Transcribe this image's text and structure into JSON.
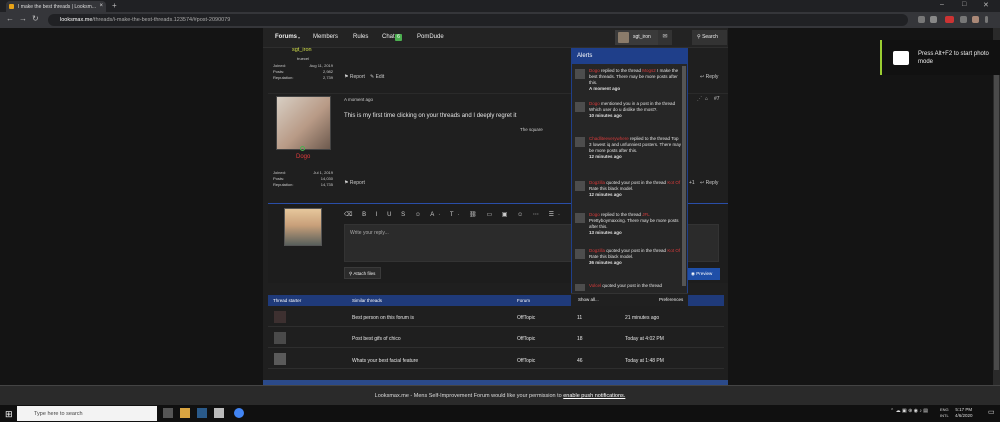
{
  "browser": {
    "tab_title": "I make the best threads | Looksm...",
    "new_tab": "+",
    "url_host": "looksmax.me",
    "url_path": "/threads/i-make-the-best-threads.123574/#post-2090079",
    "min": "–",
    "max": "□",
    "close": "✕",
    "back": "←",
    "forward": "→",
    "reload": "↻"
  },
  "nav": {
    "forums": "Forums",
    "members": "Members",
    "rules": "Rules",
    "chat": "Chat",
    "chat_badge": "6",
    "pomdude": "PomDude",
    "user": "sgt_iron",
    "search": "Search"
  },
  "post1": {
    "username": "sgt_iron",
    "title": "truecel",
    "joined_label": "Joined:",
    "joined": "Aug 11, 2019",
    "posts_label": "Posts:",
    "posts": "2,982",
    "rep_label": "Reputation:",
    "rep": "2,739",
    "report": "Report",
    "edit": "Edit",
    "reply": "Reply"
  },
  "post2": {
    "username": "Dogo",
    "time": "A moment ago",
    "text": "This is my first time clicking on your threads and I deeply regret it",
    "sub": "The square",
    "joined_label": "Joined:",
    "joined": "Jul 1, 2019",
    "posts_label": "Posts:",
    "posts": "14,030",
    "rep_label": "Reputation:",
    "rep": "14,735",
    "post_no": "#7",
    "reaction_count": "+1",
    "report": "Report",
    "reply": "Reply"
  },
  "editor": {
    "toolbar": "⌫ B I U S ☺ A· T· ⛓ ▭ ▣ ☺ ⋯ ☰· ☰· ▦",
    "placeholder": "Write your reply...",
    "attach": "Attach files",
    "preview": "Preview"
  },
  "similar": {
    "headers": [
      "Thread starter",
      "Similar threads",
      "Forum",
      "Replies",
      "Date"
    ],
    "rows": [
      {
        "title": "Best person on this forum is",
        "forum": "OffTopic",
        "replies": "11",
        "date": "21 minutes ago"
      },
      {
        "title": "Post best gifs of chico",
        "forum": "OffTopic",
        "replies": "18",
        "date": "Today at 4:02 PM"
      },
      {
        "title": "Whats your best facial feature",
        "forum": "OffTopic",
        "replies": "46",
        "date": "Today at 1:48 PM"
      }
    ]
  },
  "alerts": {
    "heading": "Alerts",
    "items": [
      {
        "user": "Dogo",
        "text": " replied to the thread ",
        "target": "Mogs2",
        "rest": "I make the best threads. There may be more posts after this.",
        "time": "A moment ago"
      },
      {
        "user": "Dogo",
        "text": " mentioned you in a post in the thread ",
        "target": "",
        "rest": "Which user do u dislike the most?.",
        "time": "10 minutes ago"
      },
      {
        "user": "Chadliteeverywhere",
        "text": " replied to the thread ",
        "target": "",
        "rest": "Top 3 lowest iq and unfunniest posters. There may be more posts after this.",
        "time": "12 minutes ago"
      },
      {
        "user": "Dogzilla",
        "text": " quoted your post in the thread ",
        "target": "Kot Of",
        "rest": "Rate this black model.",
        "time": "12 minutes ago"
      },
      {
        "user": "Dogo",
        "text": " replied to the thread ",
        "target": "JFL",
        "rest": "Prettyboymaxxing. There may be more posts after this.",
        "time": "13 minutes ago"
      },
      {
        "user": "Dogzilla",
        "text": " quoted your post in the thread ",
        "target": "Kot Of",
        "rest": "Rate this black model.",
        "time": "36 minutes ago"
      },
      {
        "user": "Volcel",
        "text": " quoted your post in the thread",
        "target": "",
        "rest": "",
        "time": ""
      }
    ],
    "show_all": "Show all...",
    "preferences": "Preferences"
  },
  "notification": {
    "text": "Looksmax.me - Mens Self-Improvement Forum would like your permission to ",
    "link": "enable push notifications."
  },
  "gamebar": {
    "text": "Press Alt+F2 to start photo mode"
  },
  "taskbar": {
    "search": "Type here to search",
    "lang_top": "ENG",
    "lang_bottom": "INTL",
    "time": "5:17 PM",
    "date": "4/6/2020"
  },
  "colors": {
    "accent": "#1f3f8a",
    "alert_user": "#d83a3a",
    "username_gold": "#d4e14b",
    "username_red": "#e03c3c"
  }
}
